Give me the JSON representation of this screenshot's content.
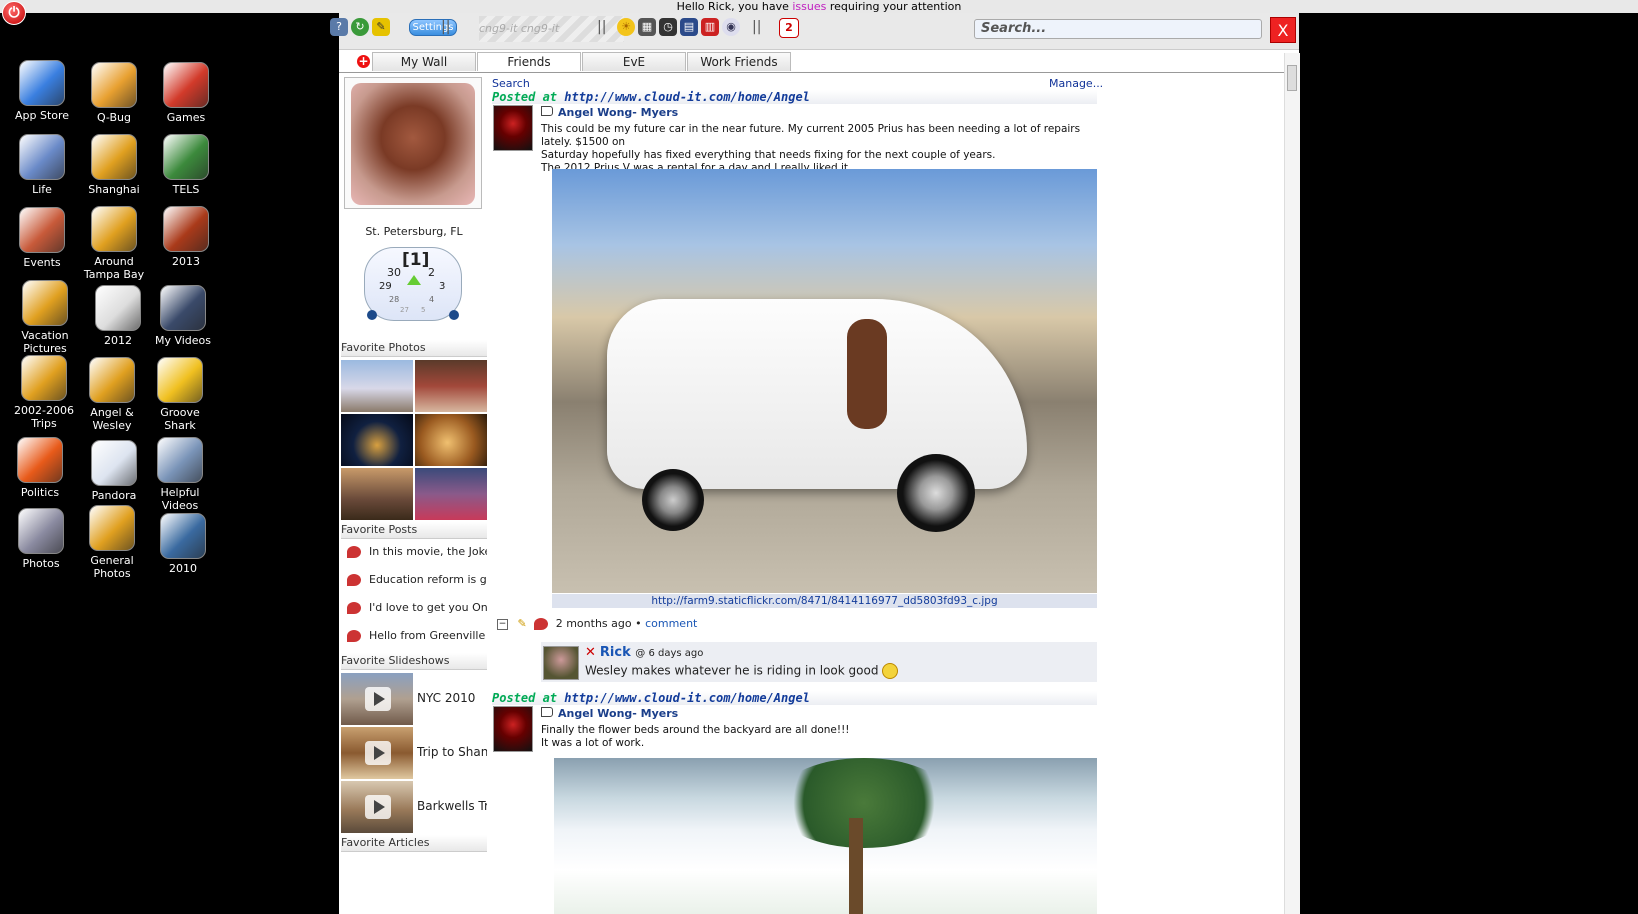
{
  "topbar": {
    "prefix": "Hello Rick, you have ",
    "highlight": "issues",
    "suffix": " requiring your attention"
  },
  "desktop_icons": [
    {
      "label": "App Store",
      "icon": "app-store-icon",
      "color": "#3a7fe0"
    },
    {
      "label": "Q-Bug",
      "icon": "ladybug-icon",
      "color": "#e8a030"
    },
    {
      "label": "Games",
      "icon": "race-car-icon",
      "color": "#d23a2a"
    },
    {
      "label": "Life",
      "icon": "photo-stack-icon",
      "color": "#6a8ac8"
    },
    {
      "label": "Shanghai",
      "icon": "palm-tree-icon",
      "color": "#e0a020"
    },
    {
      "label": "TELS",
      "icon": "chalkboard-icon",
      "color": "#3c8a3c"
    },
    {
      "label": "Events",
      "icon": "calendar-photo-icon",
      "color": "#c85a3a"
    },
    {
      "label": "Around Tampa Bay",
      "icon": "palm-tree-icon",
      "color": "#e0a020"
    },
    {
      "label": "2013",
      "icon": "photo-2013-icon",
      "color": "#aa3a1a"
    },
    {
      "label": "Vacation Pictures",
      "icon": "palm-tree-icon",
      "color": "#e0a020"
    },
    {
      "label": "2012",
      "icon": "photo-collage-icon",
      "color": "#ddd"
    },
    {
      "label": "My Videos",
      "icon": "video-camera-icon",
      "color": "#3a4a6a"
    },
    {
      "label": "2002-2006 Trips",
      "icon": "palm-tree-icon",
      "color": "#e0a020"
    },
    {
      "label": "Angel & Wesley",
      "icon": "palm-tree-icon",
      "color": "#e0a020"
    },
    {
      "label": "Groove Shark",
      "icon": "headphones-icon",
      "color": "#f0c020"
    },
    {
      "label": "Politics",
      "icon": "rss-feed-icon",
      "color": "#e85a1a"
    },
    {
      "label": "Pandora",
      "icon": "pandora-icon",
      "color": "#dde4f0"
    },
    {
      "label": "Helpful Videos",
      "icon": "clapperboard-icon",
      "color": "#7a94b8"
    },
    {
      "label": "Photos",
      "icon": "photos-app-icon",
      "color": "#8a8aa0"
    },
    {
      "label": "General Photos",
      "icon": "palm-tree-icon",
      "color": "#e0a020"
    },
    {
      "label": "2010",
      "icon": "camera-icon",
      "color": "#3a6aa0"
    }
  ],
  "toolbar": {
    "settings_label": "Settings",
    "search_placeholder": "Search...",
    "close_label": "X",
    "deco_text": "cng9-it cng9-it"
  },
  "tabs": [
    {
      "label": "My Wall",
      "active": false
    },
    {
      "label": "Friends",
      "active": true
    },
    {
      "label": "EvE",
      "active": false
    },
    {
      "label": "Work Friends",
      "active": false
    }
  ],
  "sidebar": {
    "location": "St. Petersburg, FL",
    "clock": {
      "current": "[1]",
      "left": "30",
      "right": "2",
      "far_left": "29",
      "far_right": "3",
      "small_left": "28",
      "small_right": "4",
      "tiny_left": "27",
      "tiny_right": "5"
    },
    "favorite_photos_title": "Favorite Photos",
    "favorite_posts_title": "Favorite Posts",
    "favorite_posts": [
      "In this movie, the Joker r",
      "Education reform is going",
      "I'd love to get you On a",
      "Hello from Greenville Per"
    ],
    "favorite_slideshows_title": "Favorite Slideshows",
    "slideshows": [
      "NYC 2010",
      "Trip to Shangl",
      "Barkwells Trip"
    ],
    "favorite_articles_title": "Favorite Articles"
  },
  "feed": {
    "search_label": "Search",
    "manage_label": "Manage...",
    "posts": [
      {
        "posted_prefix": "Posted at ",
        "url": "http://www.cloud-it.com/home/Angel",
        "author": "Angel Wong- Myers",
        "lines": [
          "This could be my future car in the near future. My current 2005 Prius has been needing a lot of repairs lately. $1500 on",
          "Saturday hopefully has fixed everything that needs fixing for the next couple of years.",
          "The 2012 Prius V was a rental for a day and I really liked it."
        ],
        "caption": "http://farm9.staticflickr.com/8471/8414116977_dd5803fd93_c.jpg",
        "time": "2 months ago",
        "comment_link": "comment",
        "comment": {
          "name": "Rick",
          "time": "@ 6 days ago",
          "text": "Wesley makes whatever he is riding in look good"
        }
      },
      {
        "posted_prefix": "Posted at ",
        "url": "http://www.cloud-it.com/home/Angel",
        "author": "Angel Wong- Myers",
        "lines": [
          "Finally the flower beds around the backyard are all done!!!",
          "It was a lot of work."
        ]
      }
    ]
  }
}
